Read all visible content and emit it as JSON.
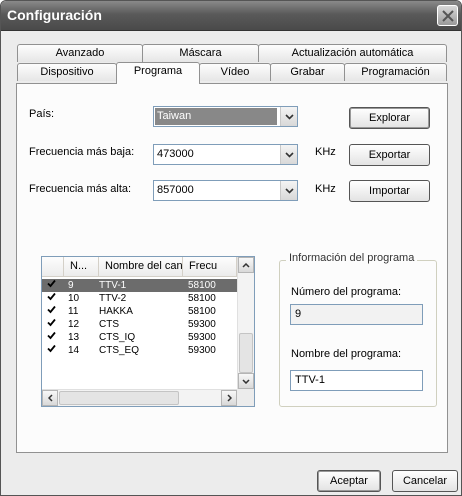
{
  "window": {
    "title": "Configuración"
  },
  "tabs_row1": [
    "Avanzado",
    "Máscara",
    "Actualización automática"
  ],
  "tabs_row2": [
    "Dispositivo",
    "Programa",
    "Vídeo",
    "Grabar",
    "Programación"
  ],
  "active_tab": "Programa",
  "form": {
    "country_label": "País:",
    "country_value": "Taiwan",
    "freq_low_label": "Frecuencia más baja:",
    "freq_low_value": "473000",
    "freq_high_label": "Frecuencia más alta:",
    "freq_high_value": "857000",
    "unit": "KHz"
  },
  "buttons": {
    "scan": "Explorar",
    "export": "Exportar",
    "import": "Importar",
    "ok": "Aceptar",
    "cancel": "Cancelar"
  },
  "channel_list": {
    "headers": [
      "N...",
      "Nombre del canal",
      "Frecu"
    ],
    "rows": [
      {
        "checked": true,
        "num": "9",
        "name": "TTV-1",
        "freq": "58100"
      },
      {
        "checked": true,
        "num": "10",
        "name": "TTV-2",
        "freq": "58100"
      },
      {
        "checked": true,
        "num": "11",
        "name": "HAKKA",
        "freq": "58100"
      },
      {
        "checked": true,
        "num": "12",
        "name": "CTS",
        "freq": "59300"
      },
      {
        "checked": true,
        "num": "13",
        "name": "CTS_IQ",
        "freq": "59300"
      },
      {
        "checked": true,
        "num": "14",
        "name": "CTS_EQ",
        "freq": "59300"
      }
    ],
    "selected_index": 0
  },
  "program_info": {
    "group_title": "Información del programa",
    "number_label": "Número del programa:",
    "number_value": "9",
    "name_label": "Nombre del programa:",
    "name_value": "TTV-1"
  }
}
